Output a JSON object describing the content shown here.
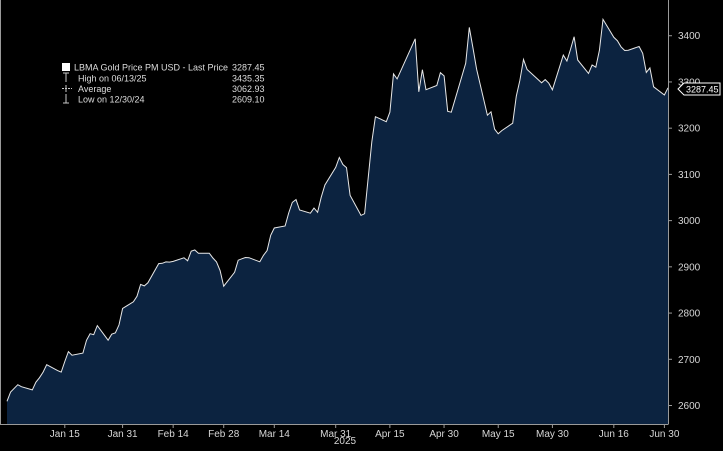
{
  "chart_data": {
    "type": "area",
    "legend": {
      "placement": "top-left",
      "items": [
        {
          "label": "LBMA Gold Price PM USD - Last Price",
          "value": "3287.45",
          "marker": "swatch"
        },
        {
          "label": "High on 06/13/25",
          "value": "3435.35",
          "marker": "high-arrow"
        },
        {
          "label": "Average",
          "value": "3062.93",
          "marker": "average-line"
        },
        {
          "label": "Low on 12/30/24",
          "value": "2609.10",
          "marker": "low-arrow"
        }
      ]
    },
    "last_value_label": "3287.45",
    "x_ticks": [
      "Jan 15",
      "Jan 31",
      "Feb 14",
      "Feb 28",
      "Mar 14",
      "Mar 31",
      "Apr 15",
      "Apr 30",
      "May 15",
      "May 30",
      "Jun 16",
      "Jun 30"
    ],
    "year_label": "2025",
    "y_ticks": [
      2600,
      2700,
      2800,
      2900,
      3000,
      3100,
      3200,
      3300,
      3400
    ],
    "ylim": [
      2560,
      3460
    ],
    "y_axis_position": "right",
    "grid": false,
    "colors": {
      "background": "#000000",
      "area_fill": "#0c2340",
      "line": "#e8e8e8",
      "axis": "#9a9a9a",
      "text": "#d6d6d6"
    },
    "series": [
      {
        "dates": [
          "12/30/24",
          "12/31/24",
          "01/02/25",
          "01/03/25",
          "01/06/25",
          "01/07/25",
          "01/08/25",
          "01/09/25",
          "01/10/25",
          "01/13/25",
          "01/14/25",
          "01/15/25",
          "01/16/25",
          "01/17/25",
          "01/20/25",
          "01/21/25",
          "01/22/25",
          "01/23/25",
          "01/24/25",
          "01/27/25",
          "01/28/25",
          "01/29/25",
          "01/30/25",
          "01/31/25",
          "02/03/25",
          "02/04/25",
          "02/05/25",
          "02/06/25",
          "02/07/25",
          "02/10/25",
          "02/11/25",
          "02/12/25",
          "02/13/25",
          "02/14/25",
          "02/17/25",
          "02/18/25",
          "02/19/25",
          "02/20/25",
          "02/21/25",
          "02/24/25",
          "02/25/25",
          "02/26/25",
          "02/27/25",
          "02/28/25",
          "03/03/25",
          "03/04/25",
          "03/05/25",
          "03/06/25",
          "03/07/25",
          "03/10/25",
          "03/11/25",
          "03/12/25",
          "03/13/25",
          "03/14/25",
          "03/17/25",
          "03/18/25",
          "03/19/25",
          "03/20/25",
          "03/21/25",
          "03/24/25",
          "03/25/25",
          "03/26/25",
          "03/27/25",
          "03/28/25",
          "03/31/25",
          "04/01/25",
          "04/02/25",
          "04/03/25",
          "04/04/25",
          "04/07/25",
          "04/08/25",
          "04/09/25",
          "04/10/25",
          "04/11/25",
          "04/14/25",
          "04/15/25",
          "04/16/25",
          "04/17/25",
          "04/22/25",
          "04/23/25",
          "04/24/25",
          "04/25/25",
          "04/28/25",
          "04/29/25",
          "04/30/25",
          "05/01/25",
          "05/02/25",
          "05/06/25",
          "05/07/25",
          "05/08/25",
          "05/09/25",
          "05/12/25",
          "05/13/25",
          "05/14/25",
          "05/15/25",
          "05/16/25",
          "05/19/25",
          "05/20/25",
          "05/21/25",
          "05/22/25",
          "05/23/25",
          "05/27/25",
          "05/28/25",
          "05/29/25",
          "05/30/25",
          "06/02/25",
          "06/03/25",
          "06/04/25",
          "06/05/25",
          "06/06/25",
          "06/09/25",
          "06/10/25",
          "06/11/25",
          "06/12/25",
          "06/13/25",
          "06/16/25",
          "06/17/25",
          "06/18/25",
          "06/19/25",
          "06/20/25",
          "06/23/25",
          "06/24/25",
          "06/25/25",
          "06/26/25",
          "06/27/25",
          "06/30/25",
          "07/01/25"
        ],
        "values": [
          2609.1,
          2629.2,
          2645.0,
          2640.8,
          2633.7,
          2650.4,
          2660.2,
          2672.3,
          2688.3,
          2675.6,
          2672.3,
          2695.2,
          2716.6,
          2708.9,
          2713.4,
          2741.0,
          2755.4,
          2753.2,
          2772.8,
          2741.4,
          2754.2,
          2757.2,
          2774.3,
          2809.9,
          2824.3,
          2836.2,
          2862.0,
          2858.7,
          2865.5,
          2907.0,
          2907.6,
          2910.7,
          2910.2,
          2911.8,
          2919.5,
          2913.0,
          2933.8,
          2936.5,
          2929.5,
          2929.5,
          2919.2,
          2910.7,
          2892.1,
          2858.2,
          2888.1,
          2914.4,
          2917.5,
          2920.2,
          2919.8,
          2910.9,
          2925.0,
          2935.4,
          2968.3,
          2984.0,
          2988.3,
          3016.5,
          3039.4,
          3045.5,
          3022.9,
          3016.0,
          3027.1,
          3017.9,
          3050.6,
          3077.15,
          3115.1,
          3136.55,
          3121.45,
          3114.8,
          3054.5,
          3011.3,
          3014.9,
          3092.7,
          3170.3,
          3224.8,
          3214.0,
          3234.8,
          3317.35,
          3306.6,
          3393.35,
          3278.75,
          3326.45,
          3283.3,
          3292.3,
          3320.1,
          3313.15,
          3236.45,
          3234.65,
          3340.35,
          3418.0,
          3373.2,
          3327.85,
          3228.0,
          3235.5,
          3198.1,
          3187.85,
          3194.75,
          3210.75,
          3269.5,
          3303.7,
          3348.7,
          3327.05,
          3298.1,
          3305.0,
          3297.3,
          3283.0,
          3358.0,
          3345.3,
          3370.5,
          3398.0,
          3347.5,
          3318.5,
          3336.7,
          3332.0,
          3368.3,
          3435.35,
          3396.7,
          3389.35,
          3376.05,
          3368.0,
          3368.8,
          3376.7,
          3362.1,
          3320.7,
          3330.5,
          3289.5,
          3271.8,
          3287.45
        ]
      }
    ]
  }
}
